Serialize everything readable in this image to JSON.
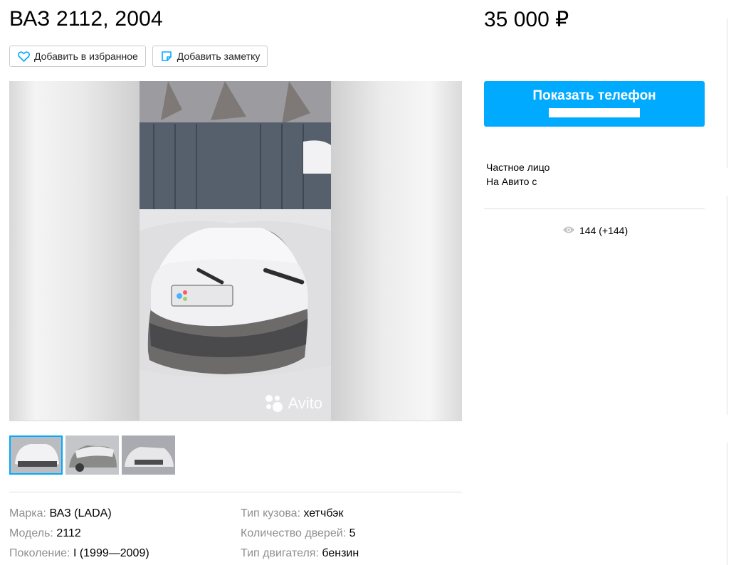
{
  "listing": {
    "title": "ВАЗ 2112, 2004",
    "price": "35 000 ₽"
  },
  "actions": {
    "favorite_label": "Добавить в избранное",
    "note_label": "Добавить заметку"
  },
  "gallery": {
    "watermark": "Avito",
    "thumbnails_count": 3
  },
  "params": [
    {
      "key": "Марка:",
      "value": "ВАЗ (LADA)"
    },
    {
      "key": "Тип кузова:",
      "value": "хетчбэк"
    },
    {
      "key": "Модель:",
      "value": "2112"
    },
    {
      "key": "Количество дверей:",
      "value": "5"
    },
    {
      "key": "Поколение:",
      "value": "I (1999—2009)"
    },
    {
      "key": "Тип двигателя:",
      "value": "бензин"
    }
  ],
  "contact": {
    "phone_button_label": "Показать телефон"
  },
  "seller": {
    "type": "Частное лицо",
    "on_avito": "На Авито с"
  },
  "stats": {
    "views": "144 (+144)"
  },
  "colors": {
    "accent": "#00aaff",
    "muted_text": "#8f8f8f"
  },
  "icons": {
    "favorite": "heart-icon",
    "note": "note-icon",
    "views": "eye-icon"
  }
}
